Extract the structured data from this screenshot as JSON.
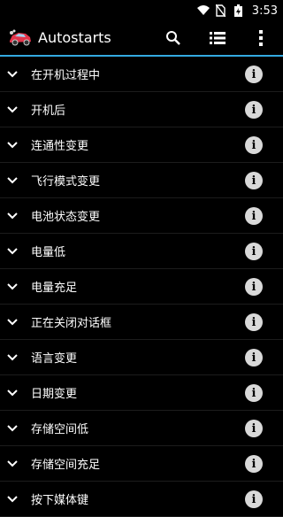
{
  "status_bar": {
    "time": "3:53",
    "icons": [
      "wifi-icon",
      "no-sim-icon",
      "battery-charging-icon"
    ]
  },
  "app_bar": {
    "title": "Autostarts",
    "logo_icon": "car-icon",
    "actions": [
      "search-icon",
      "list-view-icon",
      "overflow-menu-icon"
    ],
    "accent_color": "#34a9e0"
  },
  "events": [
    {
      "label": "在开机过程中"
    },
    {
      "label": "开机后"
    },
    {
      "label": "连通性变更"
    },
    {
      "label": "飞行模式变更"
    },
    {
      "label": "电池状态变更"
    },
    {
      "label": "电量低"
    },
    {
      "label": "电量充足"
    },
    {
      "label": "正在关闭对话框"
    },
    {
      "label": "语言变更"
    },
    {
      "label": "日期变更"
    },
    {
      "label": "存储空间低"
    },
    {
      "label": "存储空间充足"
    },
    {
      "label": "按下媒体键"
    }
  ],
  "info_glyph": "i"
}
